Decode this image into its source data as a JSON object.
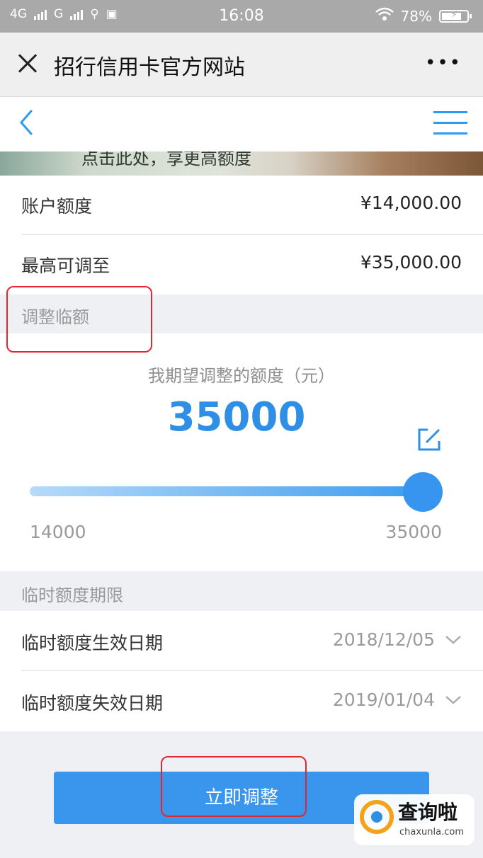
{
  "status_bar": {
    "network1": "4G",
    "network2": "G",
    "time": "16:08",
    "battery": "78%",
    "battery_level": 0.78
  },
  "wechat_bar": {
    "title": "招行信用卡官方网站",
    "more": "•••"
  },
  "banner": {
    "text": "点击此处，享更高额度"
  },
  "account": {
    "limit_label": "账户额度",
    "limit_value": "¥14,000.00",
    "max_label": "最高可调至",
    "max_value": "¥35,000.00"
  },
  "adjust": {
    "section_title": "调整临额",
    "expect_label": "我期望调整的额度（元）",
    "amount": "35000",
    "slider_min": "14000",
    "slider_max": "35000",
    "slider_value": 35000
  },
  "period": {
    "section_title": "临时额度期限",
    "start_label": "临时额度生效日期",
    "start_value": "2018/12/05",
    "end_label": "临时额度失效日期",
    "end_value": "2019/01/04"
  },
  "submit_label": "立即调整",
  "watermark": {
    "cn": "查询啦",
    "en": "chaxunla.com"
  },
  "colors": {
    "accent": "#3a95ec",
    "annotation": "#e2272f"
  }
}
